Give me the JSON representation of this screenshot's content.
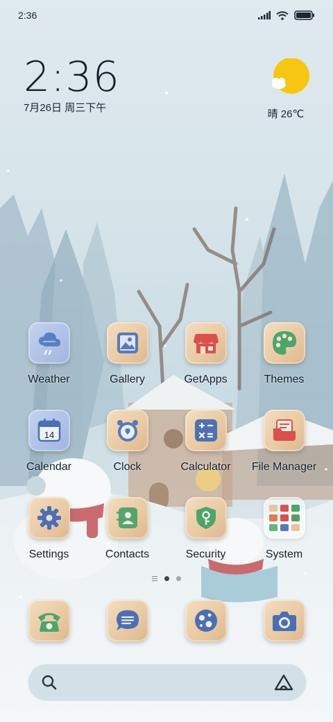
{
  "status_bar": {
    "time": "2:36"
  },
  "clock_widget": {
    "time": "2:36",
    "date": "7月26日 周三下午"
  },
  "weather_widget": {
    "condition_temp": "晴 26℃"
  },
  "apps": [
    [
      {
        "label": "Weather"
      },
      {
        "label": "Gallery"
      },
      {
        "label": "GetApps"
      },
      {
        "label": "Themes"
      }
    ],
    [
      {
        "label": "Calendar",
        "date_number": "14"
      },
      {
        "label": "Clock"
      },
      {
        "label": "Calculator"
      },
      {
        "label": "File Manager"
      }
    ],
    [
      {
        "label": "Settings"
      },
      {
        "label": "Contacts"
      },
      {
        "label": "Security"
      },
      {
        "label": "System"
      }
    ]
  ],
  "dock": [
    {
      "icon": "phone-icon"
    },
    {
      "icon": "messages-icon"
    },
    {
      "icon": "browser-icon"
    },
    {
      "icon": "camera-icon"
    }
  ],
  "page_indicator": {
    "pages": 2,
    "active": 1
  },
  "colors": {
    "icon_blue": "#4a6fb5",
    "icon_green": "#5aa86a",
    "icon_red": "#d65457",
    "icon_wood": "#ecd1ad",
    "sun": "#f7c613"
  }
}
